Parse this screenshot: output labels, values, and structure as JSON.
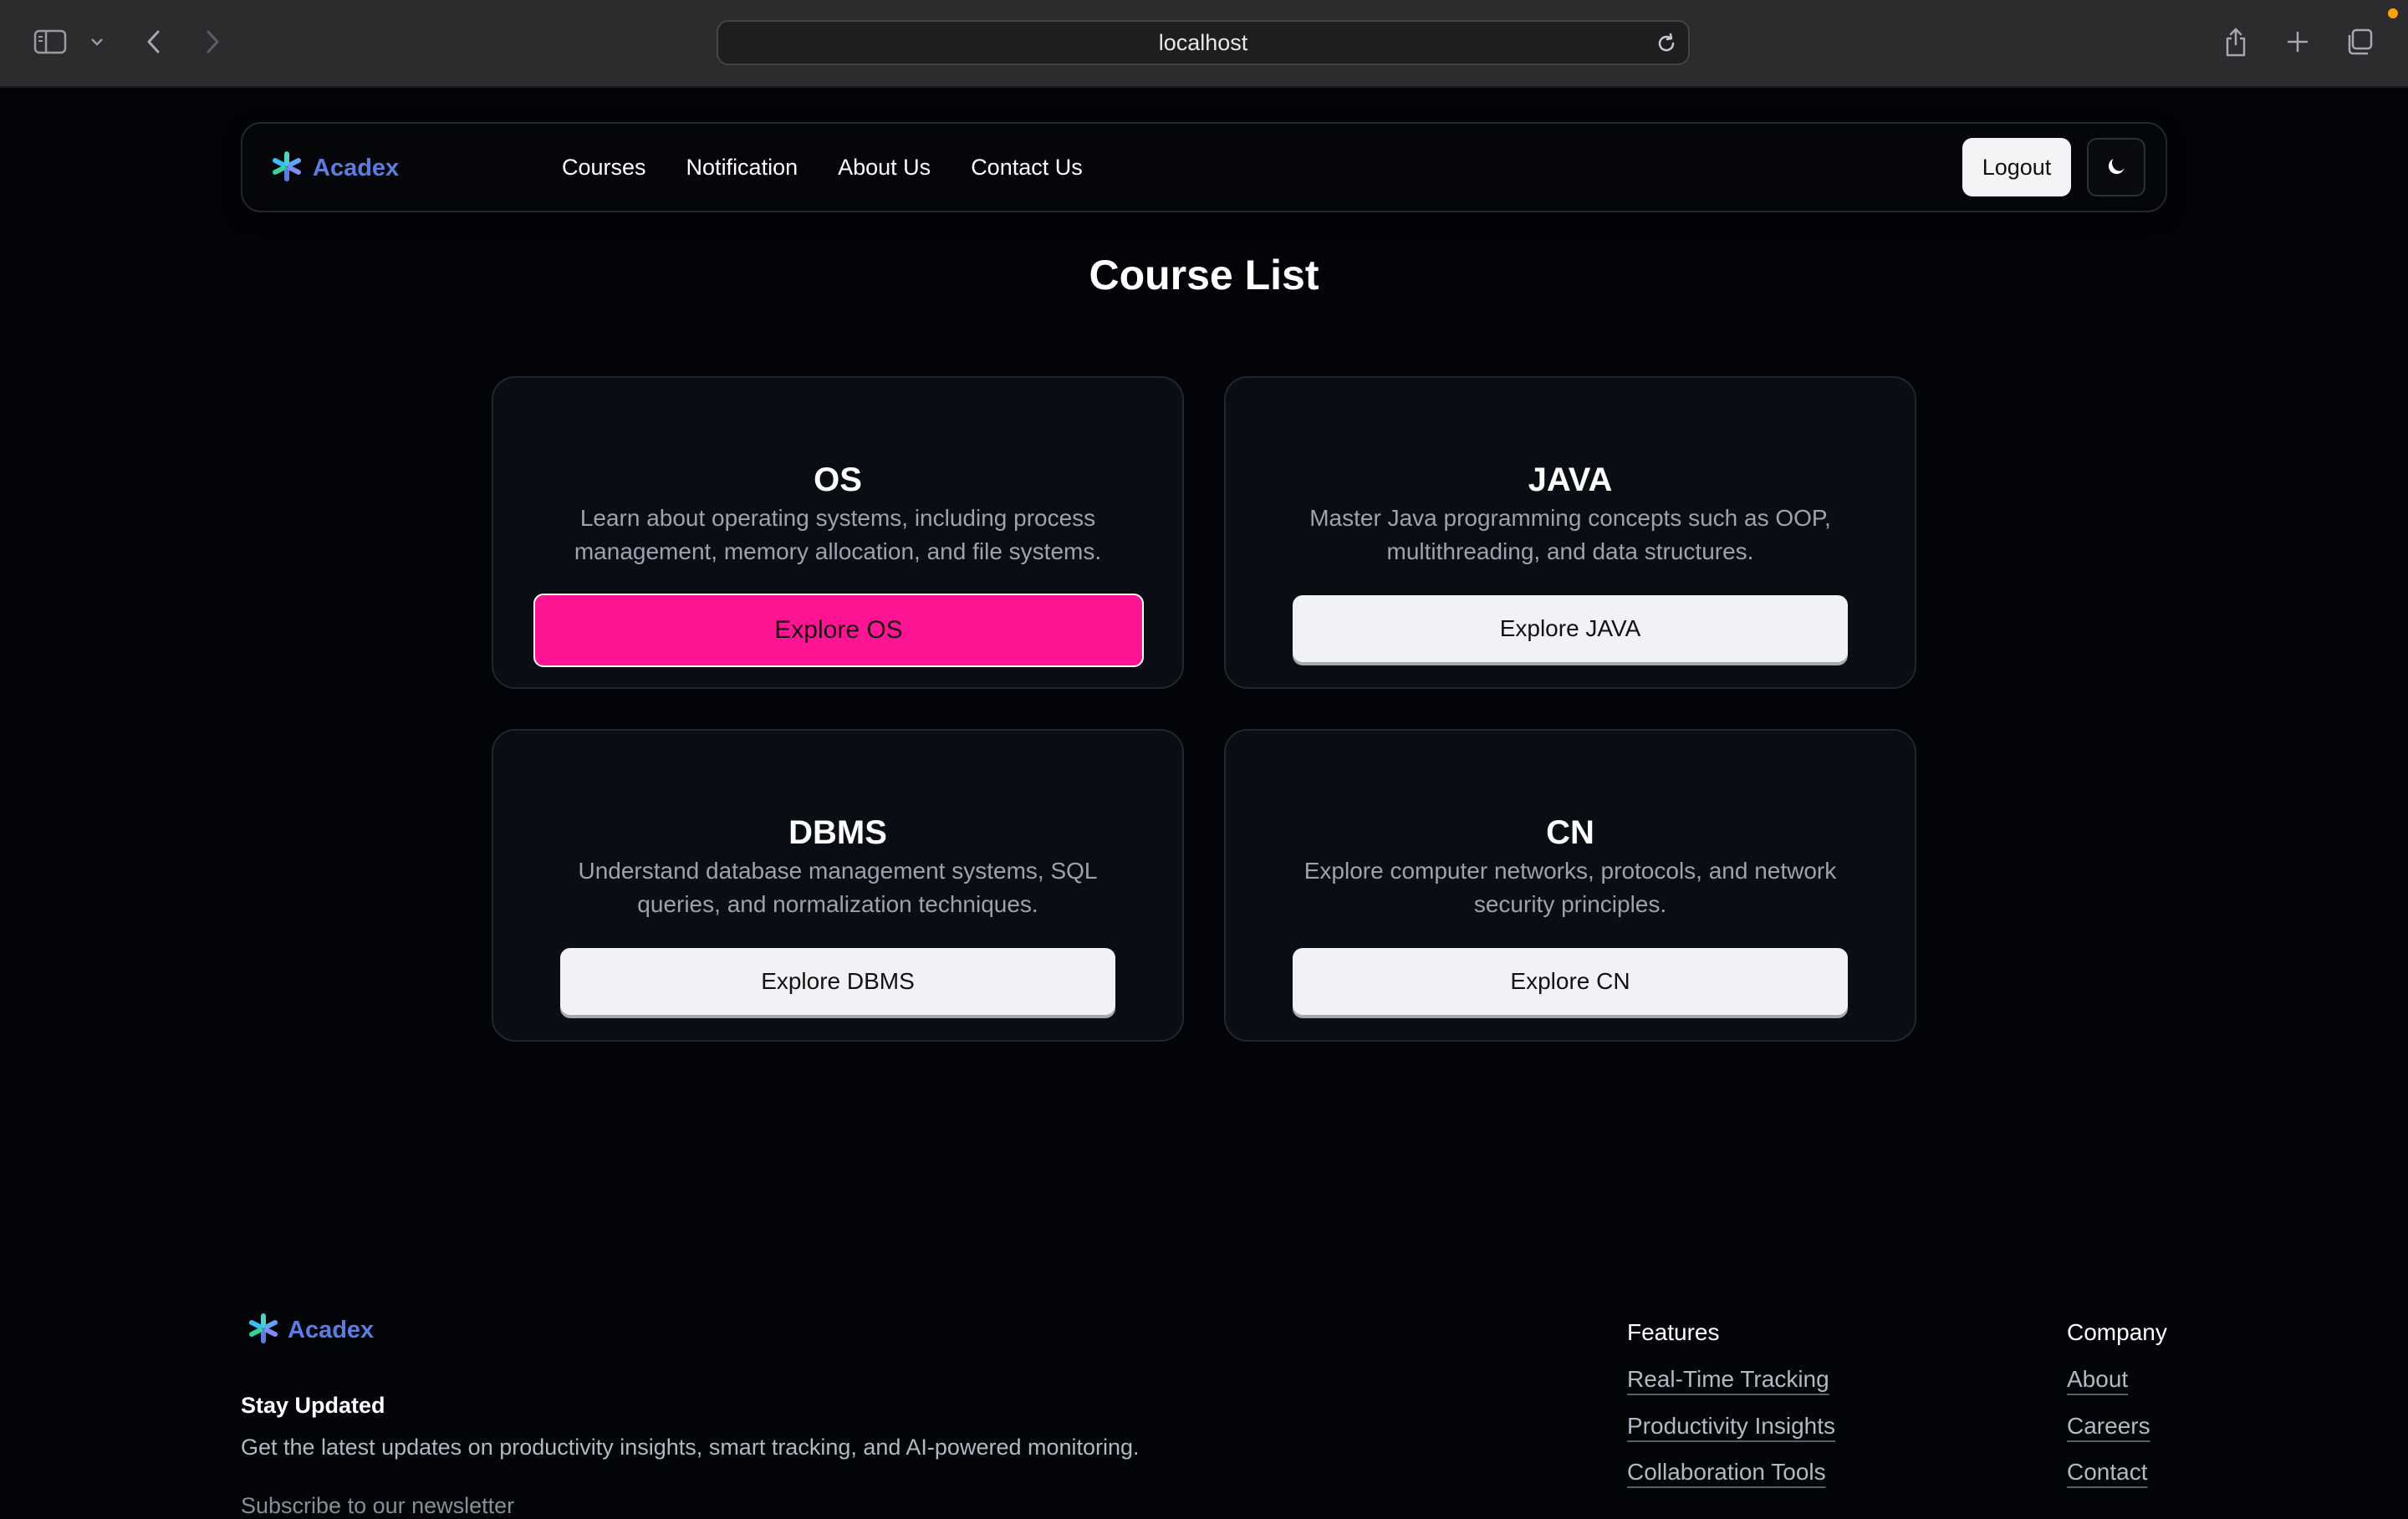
{
  "browser": {
    "url": "localhost",
    "icons": [
      "sidebar-icon",
      "chevron-down-icon",
      "back-icon",
      "forward-icon",
      "reload-icon",
      "share-icon",
      "new-tab-icon",
      "tabs-overview-icon"
    ]
  },
  "navbar": {
    "brand": "Acadex",
    "links": [
      "Courses",
      "Notification",
      "About Us",
      "Contact Us"
    ],
    "logout_label": "Logout",
    "theme_icon": "moon-icon"
  },
  "main": {
    "title": "Course List",
    "courses": [
      {
        "title": "OS",
        "description": "Learn about operating systems, including process management, memory allocation, and file systems.",
        "button": "Explore OS",
        "hovered": true
      },
      {
        "title": "JAVA",
        "description": "Master Java programming concepts such as OOP, multithreading, and data structures.",
        "button": "Explore JAVA",
        "hovered": false
      },
      {
        "title": "DBMS",
        "description": "Understand database management systems, SQL queries, and normalization techniques.",
        "button": "Explore DBMS",
        "hovered": false
      },
      {
        "title": "CN",
        "description": "Explore computer networks, protocols, and network security principles.",
        "button": "Explore CN",
        "hovered": false
      }
    ]
  },
  "footer": {
    "brand": "Acadex",
    "heading": "Stay Updated",
    "text": "Get the latest updates on productivity insights, smart tracking, and AI-powered monitoring.",
    "cut_text": "Subscribe to our newsletter",
    "features_title": "Features",
    "features": [
      "Real-Time Tracking",
      "Productivity Insights",
      "Collaboration Tools"
    ],
    "company_title": "Company",
    "company": [
      "About",
      "Careers",
      "Contact"
    ]
  },
  "colors": {
    "background": "#030408",
    "brand": "#5b7de0",
    "accent": "#ff1493",
    "card": "#0b0d15",
    "muted_text": "#9ca3af"
  }
}
